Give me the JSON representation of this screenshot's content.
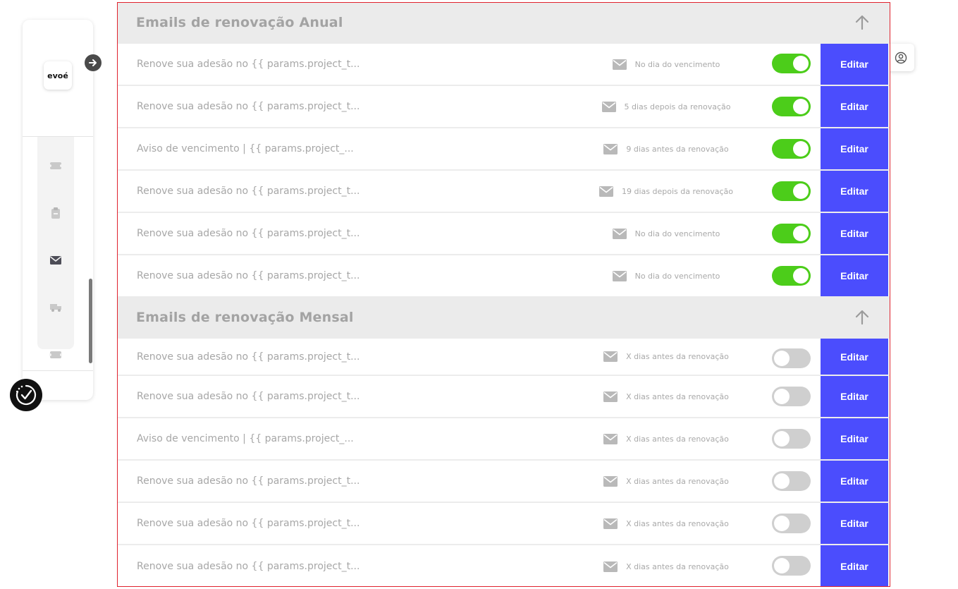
{
  "logo": {
    "text": "evoé"
  },
  "colors": {
    "accent": "#4b4dfd",
    "toggle_on": "#4ccd1a",
    "toggle_off": "#cfcfcf",
    "section_header_bg": "#ebebeb"
  },
  "sidebar": {
    "icons": [
      "ticket-icon",
      "clipboard-icon",
      "mail-icon",
      "truck-icon",
      "ticket-icon"
    ]
  },
  "sections": [
    {
      "title": "Emails de renovação Anual",
      "rows": [
        {
          "subject": "Renove sua adesão no {{ params.project_t...",
          "schedule": "No dia do vencimento",
          "enabled": true,
          "edit_label": "Editar"
        },
        {
          "subject": "Renove sua adesão no {{ params.project_t...",
          "schedule": "5 dias depois da renovação",
          "enabled": true,
          "edit_label": "Editar"
        },
        {
          "subject": "Aviso de vencimento | {{ params.project_...",
          "schedule": "9 dias antes da renovação",
          "enabled": true,
          "edit_label": "Editar"
        },
        {
          "subject": "Renove sua adesão no {{ params.project_t...",
          "schedule": "19 dias depois da renovação",
          "enabled": true,
          "edit_label": "Editar"
        },
        {
          "subject": "Renove sua adesão no {{ params.project_t...",
          "schedule": "No dia do vencimento",
          "enabled": true,
          "edit_label": "Editar"
        },
        {
          "subject": "Renove sua adesão no {{ params.project_t...",
          "schedule": "No dia do vencimento",
          "enabled": true,
          "edit_label": "Editar"
        }
      ]
    },
    {
      "title": "Emails de renovação Mensal",
      "rows": [
        {
          "subject": "Renove sua adesão no {{ params.project_t...",
          "schedule": "X dias antes da renovação",
          "enabled": false,
          "edit_label": "Editar"
        },
        {
          "subject": "Renove sua adesão no {{ params.project_t...",
          "schedule": "X dias antes da renovação",
          "enabled": false,
          "edit_label": "Editar"
        },
        {
          "subject": "Aviso de vencimento | {{ params.project_...",
          "schedule": "X dias antes da renovação",
          "enabled": false,
          "edit_label": "Editar"
        },
        {
          "subject": "Renove sua adesão no {{ params.project_t...",
          "schedule": "X dias antes da renovação",
          "enabled": false,
          "edit_label": "Editar"
        },
        {
          "subject": "Renove sua adesão no {{ params.project_t...",
          "schedule": "X dias antes da renovação",
          "enabled": false,
          "edit_label": "Editar"
        },
        {
          "subject": "Renove sua adesão no {{ params.project_t...",
          "schedule": "X dias antes da renovação",
          "enabled": false,
          "edit_label": "Editar"
        }
      ]
    }
  ]
}
